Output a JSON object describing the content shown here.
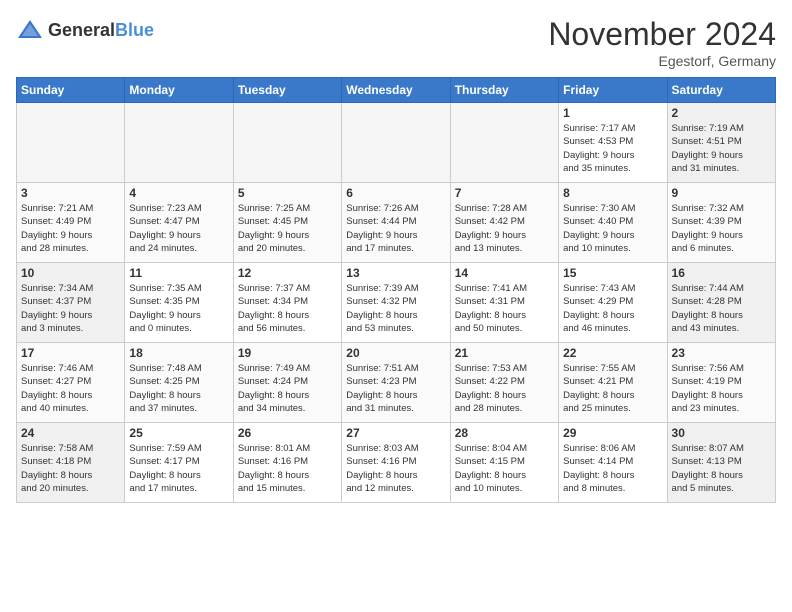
{
  "header": {
    "logo_general": "General",
    "logo_blue": "Blue",
    "month": "November 2024",
    "location": "Egestorf, Germany"
  },
  "days_of_week": [
    "Sunday",
    "Monday",
    "Tuesday",
    "Wednesday",
    "Thursday",
    "Friday",
    "Saturday"
  ],
  "weeks": [
    [
      {
        "day": "",
        "info": ""
      },
      {
        "day": "",
        "info": ""
      },
      {
        "day": "",
        "info": ""
      },
      {
        "day": "",
        "info": ""
      },
      {
        "day": "",
        "info": ""
      },
      {
        "day": "1",
        "info": "Sunrise: 7:17 AM\nSunset: 4:53 PM\nDaylight: 9 hours\nand 35 minutes."
      },
      {
        "day": "2",
        "info": "Sunrise: 7:19 AM\nSunset: 4:51 PM\nDaylight: 9 hours\nand 31 minutes."
      }
    ],
    [
      {
        "day": "3",
        "info": "Sunrise: 7:21 AM\nSunset: 4:49 PM\nDaylight: 9 hours\nand 28 minutes."
      },
      {
        "day": "4",
        "info": "Sunrise: 7:23 AM\nSunset: 4:47 PM\nDaylight: 9 hours\nand 24 minutes."
      },
      {
        "day": "5",
        "info": "Sunrise: 7:25 AM\nSunset: 4:45 PM\nDaylight: 9 hours\nand 20 minutes."
      },
      {
        "day": "6",
        "info": "Sunrise: 7:26 AM\nSunset: 4:44 PM\nDaylight: 9 hours\nand 17 minutes."
      },
      {
        "day": "7",
        "info": "Sunrise: 7:28 AM\nSunset: 4:42 PM\nDaylight: 9 hours\nand 13 minutes."
      },
      {
        "day": "8",
        "info": "Sunrise: 7:30 AM\nSunset: 4:40 PM\nDaylight: 9 hours\nand 10 minutes."
      },
      {
        "day": "9",
        "info": "Sunrise: 7:32 AM\nSunset: 4:39 PM\nDaylight: 9 hours\nand 6 minutes."
      }
    ],
    [
      {
        "day": "10",
        "info": "Sunrise: 7:34 AM\nSunset: 4:37 PM\nDaylight: 9 hours\nand 3 minutes."
      },
      {
        "day": "11",
        "info": "Sunrise: 7:35 AM\nSunset: 4:35 PM\nDaylight: 9 hours\nand 0 minutes."
      },
      {
        "day": "12",
        "info": "Sunrise: 7:37 AM\nSunset: 4:34 PM\nDaylight: 8 hours\nand 56 minutes."
      },
      {
        "day": "13",
        "info": "Sunrise: 7:39 AM\nSunset: 4:32 PM\nDaylight: 8 hours\nand 53 minutes."
      },
      {
        "day": "14",
        "info": "Sunrise: 7:41 AM\nSunset: 4:31 PM\nDaylight: 8 hours\nand 50 minutes."
      },
      {
        "day": "15",
        "info": "Sunrise: 7:43 AM\nSunset: 4:29 PM\nDaylight: 8 hours\nand 46 minutes."
      },
      {
        "day": "16",
        "info": "Sunrise: 7:44 AM\nSunset: 4:28 PM\nDaylight: 8 hours\nand 43 minutes."
      }
    ],
    [
      {
        "day": "17",
        "info": "Sunrise: 7:46 AM\nSunset: 4:27 PM\nDaylight: 8 hours\nand 40 minutes."
      },
      {
        "day": "18",
        "info": "Sunrise: 7:48 AM\nSunset: 4:25 PM\nDaylight: 8 hours\nand 37 minutes."
      },
      {
        "day": "19",
        "info": "Sunrise: 7:49 AM\nSunset: 4:24 PM\nDaylight: 8 hours\nand 34 minutes."
      },
      {
        "day": "20",
        "info": "Sunrise: 7:51 AM\nSunset: 4:23 PM\nDaylight: 8 hours\nand 31 minutes."
      },
      {
        "day": "21",
        "info": "Sunrise: 7:53 AM\nSunset: 4:22 PM\nDaylight: 8 hours\nand 28 minutes."
      },
      {
        "day": "22",
        "info": "Sunrise: 7:55 AM\nSunset: 4:21 PM\nDaylight: 8 hours\nand 25 minutes."
      },
      {
        "day": "23",
        "info": "Sunrise: 7:56 AM\nSunset: 4:19 PM\nDaylight: 8 hours\nand 23 minutes."
      }
    ],
    [
      {
        "day": "24",
        "info": "Sunrise: 7:58 AM\nSunset: 4:18 PM\nDaylight: 8 hours\nand 20 minutes."
      },
      {
        "day": "25",
        "info": "Sunrise: 7:59 AM\nSunset: 4:17 PM\nDaylight: 8 hours\nand 17 minutes."
      },
      {
        "day": "26",
        "info": "Sunrise: 8:01 AM\nSunset: 4:16 PM\nDaylight: 8 hours\nand 15 minutes."
      },
      {
        "day": "27",
        "info": "Sunrise: 8:03 AM\nSunset: 4:16 PM\nDaylight: 8 hours\nand 12 minutes."
      },
      {
        "day": "28",
        "info": "Sunrise: 8:04 AM\nSunset: 4:15 PM\nDaylight: 8 hours\nand 10 minutes."
      },
      {
        "day": "29",
        "info": "Sunrise: 8:06 AM\nSunset: 4:14 PM\nDaylight: 8 hours\nand 8 minutes."
      },
      {
        "day": "30",
        "info": "Sunrise: 8:07 AM\nSunset: 4:13 PM\nDaylight: 8 hours\nand 5 minutes."
      }
    ]
  ]
}
